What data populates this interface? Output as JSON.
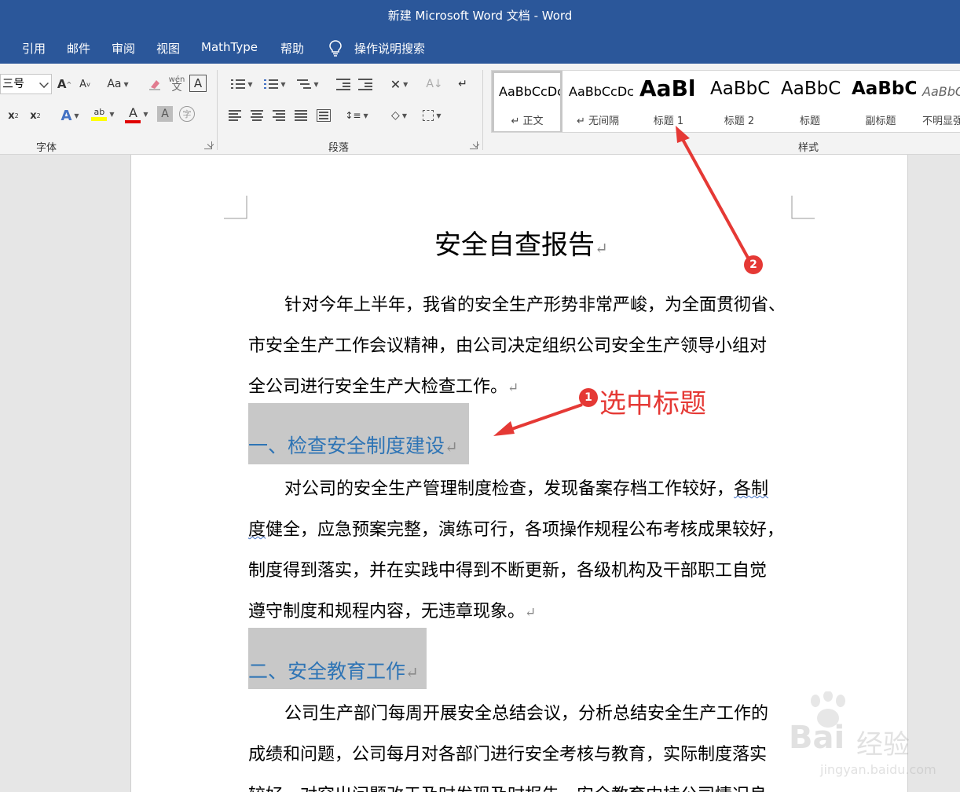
{
  "window": {
    "title": "新建 Microsoft Word 文档  -  Word"
  },
  "menu": {
    "items": [
      "引用",
      "邮件",
      "审阅",
      "视图",
      "MathType",
      "帮助"
    ],
    "search_label": "操作说明搜索"
  },
  "ribbon": {
    "font_group": {
      "label": "字体",
      "font_size": "三号"
    },
    "paragraph_group": {
      "label": "段落"
    },
    "styles_group": {
      "label": "样式",
      "styles": [
        {
          "preview": "AaBbCcDc",
          "name": "↵ 正文"
        },
        {
          "preview": "AaBbCcDc",
          "name": "↵ 无间隔"
        },
        {
          "preview": "AaBl",
          "name": "标题 1"
        },
        {
          "preview": "AaBbC",
          "name": "标题 2"
        },
        {
          "preview": "AaBbC",
          "name": "标题"
        },
        {
          "preview": "AaBbC",
          "name": "副标题"
        },
        {
          "preview": "AaBbCc",
          "name": "不明显强"
        }
      ]
    }
  },
  "document": {
    "title": "安全自查报告",
    "para1": [
      "针对今年上半年，我省的安全生产形势非常严峻，为全面贯彻省、",
      "市安全生产工作会议精神，由公司决定组织公司安全生产领导小组对",
      "全公司进行安全生产大检查工作。"
    ],
    "heading1": "一、检查安全制度建设",
    "para2": [
      "对公司的安全生产管理制度检查，发现备案存档工作较好，",
      "各制",
      "度",
      "健全，应急预案完整，演练可行，各项操作规程公布考核成果较好，",
      "制度得到落实，并在实践中得到不断更新，各级机构及干部职工自觉",
      "遵守制度和规程内容，无违章现象。"
    ],
    "heading2": "二、安全教育工作",
    "para3": [
      "公司生产部门每周开展安全总结会议，分析总结安全生产工作的",
      "成绩和问题，公司每月对各部门进行安全考核与教育，实际制度落实",
      "较好，对突出问题改于及时发现及时报告，安全教育内持公司情况良"
    ],
    "para_mark": "↵"
  },
  "annotations": {
    "badge1": "1",
    "badge2": "2",
    "label1": "选中标题"
  },
  "watermark": {
    "brand": "Bai",
    "brand2": "经验",
    "url": "jingyan.baidu.com"
  },
  "colors": {
    "brand_blue": "#2b579a",
    "heading_blue": "#2e74b5",
    "annotation_red": "#e53935",
    "selection_gray": "#c8c8c8"
  }
}
